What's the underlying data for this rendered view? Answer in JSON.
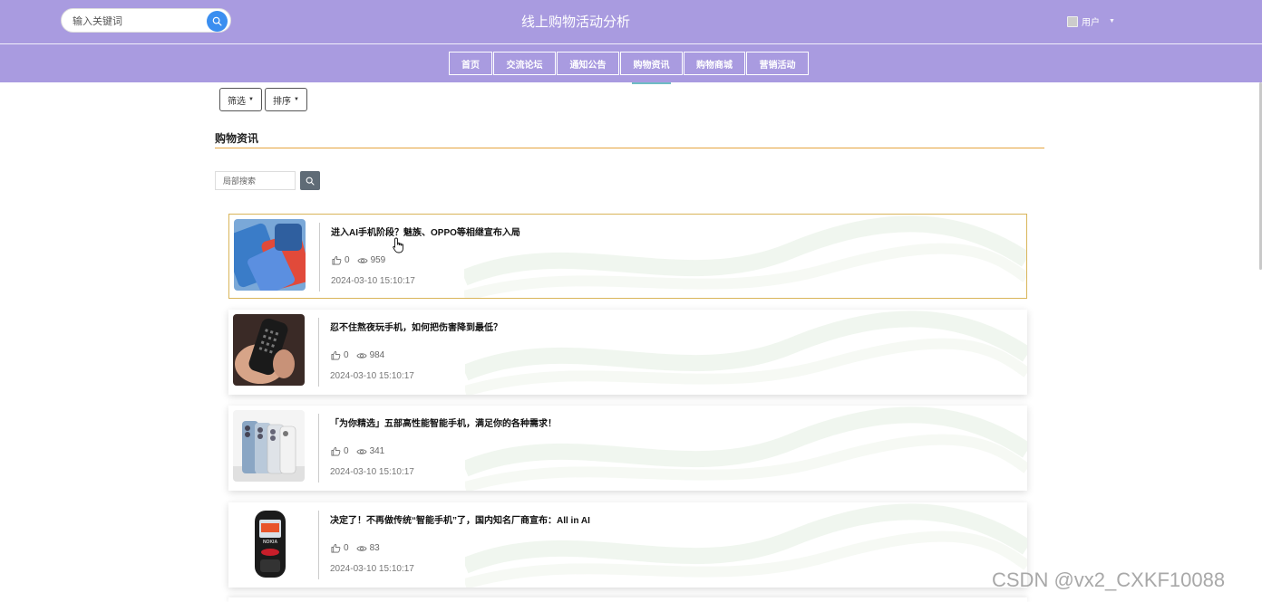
{
  "header": {
    "search_placeholder": "输入关键词",
    "site_title": "线上购物活动分析",
    "user_label": "用户"
  },
  "nav": {
    "items": [
      {
        "label": "首页",
        "width": 48
      },
      {
        "label": "交流论坛",
        "width": 69
      },
      {
        "label": "通知公告",
        "width": 69
      },
      {
        "label": "购物资讯",
        "width": 69
      },
      {
        "label": "购物商城",
        "width": 68
      },
      {
        "label": "营销活动",
        "width": 69
      }
    ],
    "active_index": 3
  },
  "filters": {
    "filter_label": "筛选",
    "sort_label": "排序"
  },
  "section": {
    "title": "购物资讯",
    "local_search_placeholder": "局部搜索"
  },
  "articles": [
    {
      "title": "进入AI手机阶段？魅族、OPPO等相继宣布入局",
      "likes": "0",
      "views": "959",
      "date": "2024-03-10 15:10:17",
      "thumb": "phones-red-blue"
    },
    {
      "title": "忍不住熬夜玩手机，如何把伤害降到最低？",
      "likes": "0",
      "views": "984",
      "date": "2024-03-10 15:10:17",
      "thumb": "phone-in-hand"
    },
    {
      "title": "「为你精选」五部高性能智能手机，满足你的各种需求！",
      "likes": "0",
      "views": "341",
      "date": "2024-03-10 15:10:17",
      "thumb": "iphone-lineup"
    },
    {
      "title": "决定了！不再做传统“智能手机”了，国内知名厂商宣布：All in AI",
      "likes": "0",
      "views": "83",
      "date": "2024-03-10 15:10:17",
      "thumb": "nokia-phone"
    }
  ],
  "thumb_texts": {
    "nokia_brand": "NOKIA"
  },
  "watermark": "CSDN @vx2_CXKF10088",
  "colors": {
    "header_bg": "#a99be0",
    "search_btn": "#3a8ef0",
    "section_underline": "#e6a53e",
    "highlight_border": "#d9b55a",
    "active_tab_indicator": "#6fbcc4"
  }
}
